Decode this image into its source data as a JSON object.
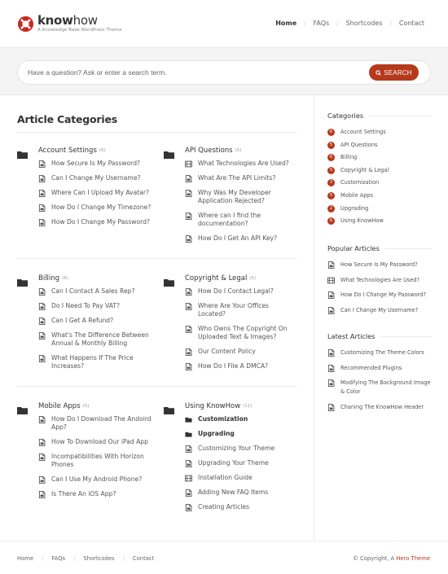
{
  "header": {
    "logo_bold": "know",
    "logo_light": "how",
    "tagline": "A Knowledge Base WordPress Theme",
    "nav": [
      {
        "label": "Home",
        "active": true
      },
      {
        "label": "FAQs",
        "active": false
      },
      {
        "label": "Shortcodes",
        "active": false
      },
      {
        "label": "Contact",
        "active": false
      }
    ],
    "nav_separator": "/"
  },
  "search": {
    "placeholder": "Have a question? Ask or enter a search term.",
    "value": "",
    "button_label": "SEARCH"
  },
  "main": {
    "title": "Article Categories",
    "categories": [
      {
        "title": "Account Settings",
        "count": "(6)",
        "items": [
          {
            "label": "How Secure Is My Password?",
            "icon": "document"
          },
          {
            "label": "Can I Change My Username?",
            "icon": "document"
          },
          {
            "label": "Where Can I Upload My Avatar?",
            "icon": "document"
          },
          {
            "label": "How Do I Change My Timezone?",
            "icon": "document"
          },
          {
            "label": "How Do I Change My Password?",
            "icon": "document"
          }
        ]
      },
      {
        "title": "API Questions",
        "count": "(5)",
        "items": [
          {
            "label": "What Technologies Are Used?",
            "icon": "video"
          },
          {
            "label": "What Are The API Limits?",
            "icon": "document"
          },
          {
            "label": "Why Was My Developer Application Rejected?",
            "icon": "document"
          },
          {
            "label": "Where can I find the documentation?",
            "icon": "document"
          },
          {
            "label": "How Do I Get An API Key?",
            "icon": "document"
          }
        ]
      },
      {
        "title": "Billing",
        "count": "(6)",
        "items": [
          {
            "label": "Can I Contact A Sales Rep?",
            "icon": "document"
          },
          {
            "label": "Do I Need To Pay VAT?",
            "icon": "document"
          },
          {
            "label": "Can I Get A Refund?",
            "icon": "document"
          },
          {
            "label": "What's The Difference Between Annual & Monthly Billing",
            "icon": "document"
          },
          {
            "label": "What Happens If The Price Increases?",
            "icon": "document"
          }
        ]
      },
      {
        "title": "Copyright & Legal",
        "count": "(5)",
        "items": [
          {
            "label": "How Do I Contact Legal?",
            "icon": "document"
          },
          {
            "label": "Where Are Your Offices Located?",
            "icon": "document"
          },
          {
            "label": "Who Owns The Copyright On Uploaded Text & Images?",
            "icon": "document"
          },
          {
            "label": "Our Content Policy",
            "icon": "document"
          },
          {
            "label": "How Do I File A DMCA?",
            "icon": "document"
          }
        ]
      },
      {
        "title": "Mobile Apps",
        "count": "(5)",
        "items": [
          {
            "label": "How Do I Download The Andoird App?",
            "icon": "document"
          },
          {
            "label": "How To Download Our iPad App",
            "icon": "document"
          },
          {
            "label": "Incompatibilities With Horizon Phones",
            "icon": "document"
          },
          {
            "label": "Can I Use My Android Phone?",
            "icon": "document"
          },
          {
            "label": "Is There An iOS App?",
            "icon": "document"
          }
        ]
      },
      {
        "title": "Using KnowHow",
        "count": "(11)",
        "items": [
          {
            "label": "Customization",
            "icon": "folder",
            "sub": true
          },
          {
            "label": "Upgrading",
            "icon": "folder",
            "sub": true
          },
          {
            "label": "Customizing Your Theme",
            "icon": "document"
          },
          {
            "label": "Upgrading Your Theme",
            "icon": "document"
          },
          {
            "label": "Installation Guide",
            "icon": "video"
          },
          {
            "label": "Adding New FAQ Items",
            "icon": "document"
          },
          {
            "label": "Creating Articles",
            "icon": "document"
          }
        ]
      }
    ]
  },
  "sidebar": {
    "categories_title": "Categories",
    "categories": [
      {
        "count": "6",
        "label": "Account Settings"
      },
      {
        "count": "5",
        "label": "API Questions"
      },
      {
        "count": "6",
        "label": "Billing"
      },
      {
        "count": "5",
        "label": "Copyright & Legal"
      },
      {
        "count": "3",
        "label": "Customization"
      },
      {
        "count": "5",
        "label": "Mobile Apps"
      },
      {
        "count": "2",
        "label": "Upgrading"
      },
      {
        "count": "6",
        "label": "Using KnowHow"
      }
    ],
    "popular_title": "Popular Articles",
    "popular": [
      {
        "label": "How Secure Is My Password?",
        "icon": "document"
      },
      {
        "label": "What Technologies Are Used?",
        "icon": "video"
      },
      {
        "label": "How Do I Change My Password?",
        "icon": "document"
      },
      {
        "label": "Can I Change My Username?",
        "icon": "document"
      }
    ],
    "latest_title": "Latest Articles",
    "latest": [
      {
        "label": "Customizing The Theme Colors",
        "icon": "document"
      },
      {
        "label": "Recommended Plugins",
        "icon": "document"
      },
      {
        "label": "Modifying The Background Image & Color",
        "icon": "document"
      },
      {
        "label": "Chaning The KnowHow Header",
        "icon": "document"
      }
    ]
  },
  "footer": {
    "nav": [
      "Home",
      "FAQs",
      "Shortcodes",
      "Contact"
    ],
    "nav_separator": "/",
    "copyright_prefix": "© Copyright, A ",
    "copyright_link": "Hero Theme"
  },
  "colors": {
    "accent": "#b5391b",
    "heading": "#333333",
    "text": "#555555",
    "band": "#f4f4f4"
  }
}
